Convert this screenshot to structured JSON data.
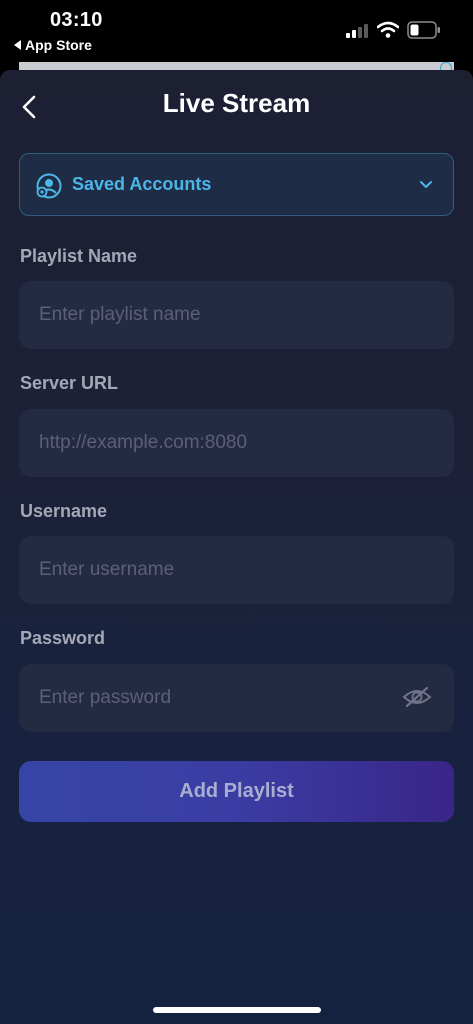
{
  "status_bar": {
    "time": "03:10",
    "back_app": "App Store"
  },
  "header": {
    "title": "Live Stream"
  },
  "saved_accounts": {
    "label": "Saved Accounts",
    "accent_color": "#4bb6e8"
  },
  "form": {
    "playlist_name": {
      "label": "Playlist Name",
      "placeholder": "Enter playlist name",
      "value": ""
    },
    "server_url": {
      "label": "Server URL",
      "placeholder": "http://example.com:8080",
      "value": ""
    },
    "username": {
      "label": "Username",
      "placeholder": "Enter username",
      "value": ""
    },
    "password": {
      "label": "Password",
      "placeholder": "Enter password",
      "value": ""
    }
  },
  "actions": {
    "add_playlist_label": "Add Playlist"
  },
  "icons": {
    "back": "chevron-left-icon",
    "accounts": "accounts-icon",
    "dropdown": "chevron-down-icon",
    "password_visibility": "eye-slash-icon"
  }
}
